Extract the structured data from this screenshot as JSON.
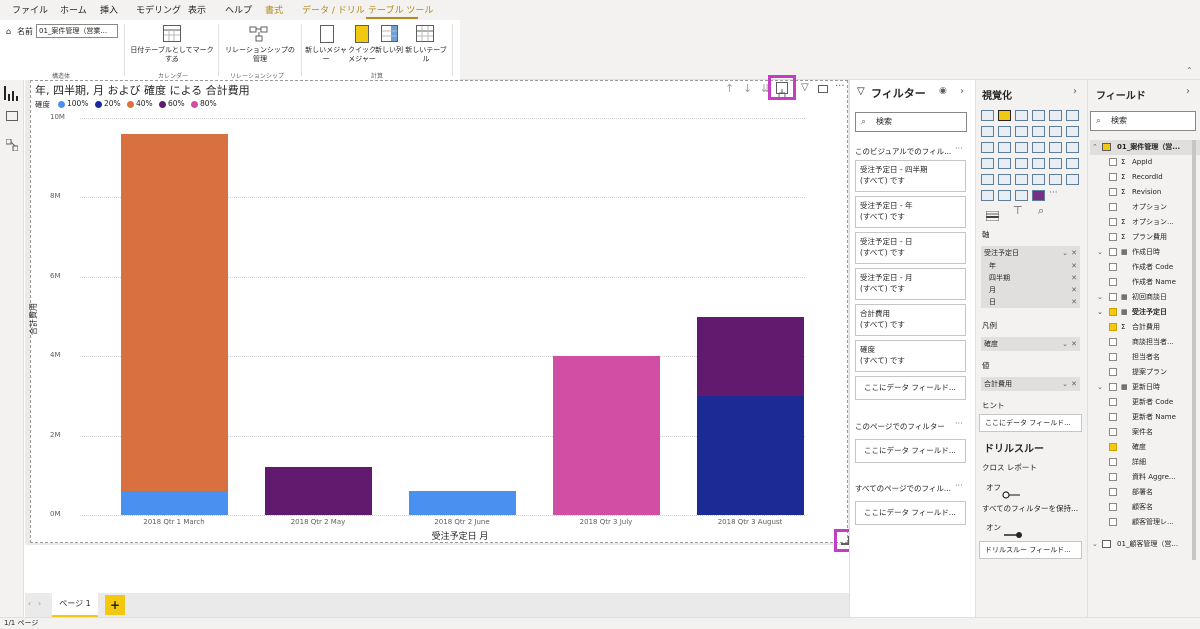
{
  "ribbon": {
    "tabs": [
      "ファイル",
      "ホーム",
      "挿入",
      "モデリング",
      "表示",
      "ヘルプ",
      "書式",
      "データ / ドリル",
      "テーブル ツール"
    ],
    "active_tab": "テーブル ツール",
    "name_label": "名前",
    "name_value": "01_案件管理（営業...",
    "buttons": {
      "mark_date": "日付テーブルとしてマークする",
      "relations": "リレーションシップの管理",
      "new_measure": "新しいメジャー",
      "quick_measure": "クイック\nメジャー",
      "new_column": "新しい列",
      "new_table": "新しいテーブル"
    },
    "groups": {
      "structure": "構造体",
      "calendar": "カレンダー",
      "relations": "リレーションシップ",
      "calc": "計算"
    }
  },
  "visual": {
    "title": "年, 四半期, 月 および 確度 による 合計費用",
    "legend_title": "確度",
    "xlabel": "受注予定日 月",
    "ylabel": "合計費用"
  },
  "chart_data": {
    "type": "bar",
    "stacked": true,
    "title": "年, 四半期, 月 および 確度 による 合計費用",
    "xlabel": "受注予定日 月",
    "ylabel": "合計費用",
    "ylim": [
      0,
      10000000
    ],
    "ytick_labels": [
      "0M",
      "2M",
      "4M",
      "6M",
      "8M",
      "10M"
    ],
    "legend_position": "top-left",
    "categories": [
      "2018 Qtr 1 March",
      "2018 Qtr 2 May",
      "2018 Qtr 2 June",
      "2018 Qtr 3 July",
      "2018 Qtr 3 August"
    ],
    "series": [
      {
        "name": "100%",
        "color": "#4a90f0",
        "values": [
          600000,
          0,
          600000,
          0,
          0
        ]
      },
      {
        "name": "20%",
        "color": "#1c2a96",
        "values": [
          0,
          0,
          0,
          0,
          3000000
        ]
      },
      {
        "name": "40%",
        "color": "#d87040",
        "values": [
          9000000,
          0,
          0,
          0,
          0
        ]
      },
      {
        "name": "60%",
        "color": "#621a6e",
        "values": [
          0,
          1200000,
          0,
          0,
          2000000
        ]
      },
      {
        "name": "80%",
        "color": "#d04fa5",
        "values": [
          0,
          0,
          0,
          4000000,
          0
        ]
      }
    ]
  },
  "filters": {
    "title": "フィルター",
    "search_placeholder": "検索",
    "visual_section": "このビジュアルでのフィル...",
    "cards": [
      {
        "field": "受注予定日 - 四半期",
        "value": "(すべて) です"
      },
      {
        "field": "受注予定日 - 年",
        "value": "(すべて) です"
      },
      {
        "field": "受注予定日 - 日",
        "value": "(すべて) です"
      },
      {
        "field": "受注予定日 - 月",
        "value": "(すべて) です"
      },
      {
        "field": "合計費用",
        "value": "(すべて) です"
      },
      {
        "field": "確度",
        "value": "(すべて) です"
      }
    ],
    "drop_here": "ここにデータ フィールド...",
    "page_section": "このページでのフィルター",
    "all_pages_section": "すべてのページでのフィル..."
  },
  "viz": {
    "title": "視覚化",
    "axis_label": "軸",
    "axis_field": "受注予定日",
    "axis_subs": [
      "年",
      "四半期",
      "月",
      "日"
    ],
    "legend_label": "凡例",
    "legend_field": "確度",
    "value_label": "値",
    "value_field": "合計費用",
    "tooltip_label": "ヒント",
    "tooltip_drop": "ここにデータ フィールド...",
    "drill_title": "ドリルスルー",
    "cross_report": "クロス レポート",
    "off_label": "オフ",
    "keep_filters": "すべてのフィルターを保持...",
    "on_label": "オン",
    "drill_drop": "ドリルスルー フィールド..."
  },
  "fields": {
    "title": "フィールド",
    "search_placeholder": "検索",
    "table1": "01_案件管理（営...",
    "items": [
      {
        "name": "AppId",
        "sigma": true,
        "checked": false,
        "type": "field"
      },
      {
        "name": "RecordId",
        "sigma": true,
        "checked": false,
        "type": "field"
      },
      {
        "name": "Revision",
        "sigma": true,
        "checked": false,
        "type": "field"
      },
      {
        "name": "オプション",
        "sigma": false,
        "checked": false,
        "type": "field"
      },
      {
        "name": "オプション...",
        "sigma": true,
        "checked": false,
        "type": "field"
      },
      {
        "name": "プラン費用",
        "sigma": true,
        "checked": false,
        "type": "field"
      },
      {
        "name": "作成日時",
        "sigma": false,
        "checked": false,
        "type": "date"
      },
      {
        "name": "作成者 Code",
        "sigma": false,
        "checked": false,
        "type": "field"
      },
      {
        "name": "作成者 Name",
        "sigma": false,
        "checked": false,
        "type": "field"
      },
      {
        "name": "初回商談日",
        "sigma": false,
        "checked": false,
        "type": "date"
      },
      {
        "name": "受注予定日",
        "sigma": false,
        "checked": true,
        "type": "date"
      },
      {
        "name": "合計費用",
        "sigma": true,
        "checked": true,
        "type": "field"
      },
      {
        "name": "商談担当者...",
        "sigma": false,
        "checked": false,
        "type": "field"
      },
      {
        "name": "担当者名",
        "sigma": false,
        "checked": false,
        "type": "field"
      },
      {
        "name": "提案プラン",
        "sigma": false,
        "checked": false,
        "type": "field"
      },
      {
        "name": "更新日時",
        "sigma": false,
        "checked": false,
        "type": "date"
      },
      {
        "name": "更新者 Code",
        "sigma": false,
        "checked": false,
        "type": "field"
      },
      {
        "name": "更新者 Name",
        "sigma": false,
        "checked": false,
        "type": "field"
      },
      {
        "name": "案件名",
        "sigma": false,
        "checked": false,
        "type": "field"
      },
      {
        "name": "確度",
        "sigma": false,
        "checked": true,
        "type": "field"
      },
      {
        "name": "詳細",
        "sigma": false,
        "checked": false,
        "type": "field"
      },
      {
        "name": "資料 Aggre...",
        "sigma": false,
        "checked": false,
        "type": "field"
      },
      {
        "name": "部署名",
        "sigma": false,
        "checked": false,
        "type": "field"
      },
      {
        "name": "顧客名",
        "sigma": false,
        "checked": false,
        "type": "field"
      },
      {
        "name": "顧客管理レ...",
        "sigma": false,
        "checked": false,
        "type": "field"
      }
    ],
    "table2": "01_顧客管理（営..."
  },
  "pages": {
    "tab": "ページ 1",
    "add": "+",
    "status": "1/1 ページ"
  },
  "colors": {
    "accent": "#b08a1c",
    "highlight": "#c43ec4"
  }
}
